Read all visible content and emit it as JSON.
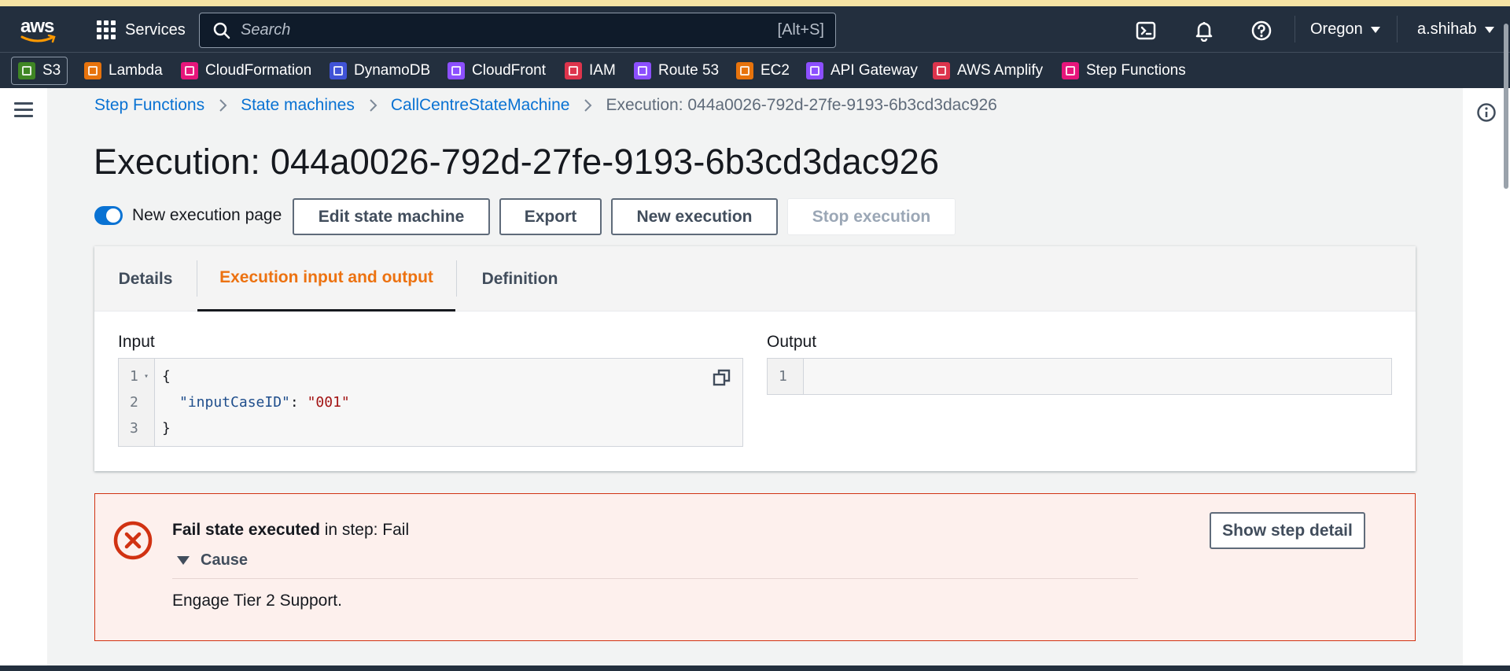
{
  "topnav": {
    "logo_text": "aws",
    "services_label": "Services",
    "search_placeholder": "Search",
    "search_shortcut": "[Alt+S]",
    "region": "Oregon",
    "user": "a.shihab"
  },
  "favorites": [
    {
      "label": "S3",
      "color": "#3f8624"
    },
    {
      "label": "Lambda",
      "color": "#e7730c"
    },
    {
      "label": "CloudFormation",
      "color": "#e7157b"
    },
    {
      "label": "DynamoDB",
      "color": "#4053d6"
    },
    {
      "label": "CloudFront",
      "color": "#8c4fff"
    },
    {
      "label": "IAM",
      "color": "#dd344c"
    },
    {
      "label": "Route 53",
      "color": "#8c4fff"
    },
    {
      "label": "EC2",
      "color": "#e7730c"
    },
    {
      "label": "API Gateway",
      "color": "#8c4fff"
    },
    {
      "label": "AWS Amplify",
      "color": "#dd344c"
    },
    {
      "label": "Step Functions",
      "color": "#e7157b"
    }
  ],
  "breadcrumb": {
    "items": [
      "Step Functions",
      "State machines",
      "CallCentreStateMachine"
    ],
    "current": "Execution: 044a0026-792d-27fe-9193-6b3cd3dac926"
  },
  "page": {
    "title": "Execution: 044a0026-792d-27fe-9193-6b3cd3dac926",
    "toggle_label": "New execution page",
    "toggle_on": true,
    "buttons": {
      "edit": "Edit state machine",
      "export": "Export",
      "new_execution": "New execution",
      "stop": "Stop execution"
    }
  },
  "tabs": {
    "items": [
      "Details",
      "Execution input and output",
      "Definition"
    ],
    "active": "Execution input and output"
  },
  "io": {
    "input_label": "Input",
    "output_label": "Output",
    "input_lines": [
      {
        "n": "1",
        "text": "{"
      },
      {
        "n": "2",
        "key": "\"inputCaseID\"",
        "sep": ": ",
        "value": "\"001\""
      },
      {
        "n": "3",
        "text": "}"
      }
    ],
    "output_lines": [
      {
        "n": "1",
        "text": ""
      }
    ]
  },
  "error": {
    "title_bold": "Fail state executed",
    "title_rest": " in step: Fail",
    "cause_label": "Cause",
    "cause_text": "Engage Tier 2 Support.",
    "button": "Show step detail",
    "accent": "#d13212"
  },
  "colors": {
    "nav_bg": "#232f3e",
    "link": "#0972d3",
    "tab_active": "#ec7211"
  }
}
